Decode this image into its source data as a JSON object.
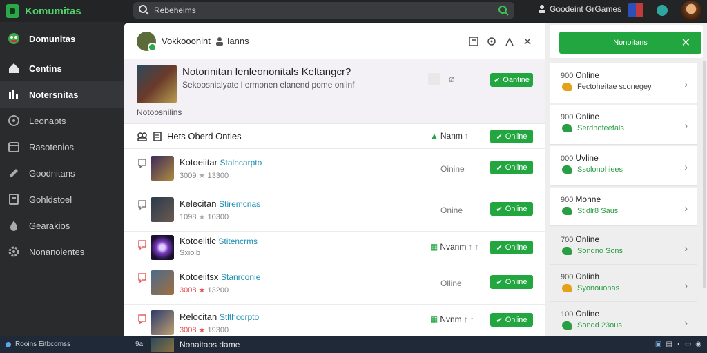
{
  "brand": {
    "name": "Komumitas"
  },
  "search": {
    "value": "Rebeheims",
    "placeholder": ""
  },
  "top_right": {
    "account_label": "Goodeint GrGames"
  },
  "sidebar": {
    "items": [
      {
        "label": "Domunitas",
        "icon": "community-icon"
      },
      {
        "label": "Centins",
        "icon": "home-icon"
      },
      {
        "label": "Notersnitas",
        "icon": "stats-icon"
      },
      {
        "label": "Leonapts",
        "icon": "compass-icon"
      },
      {
        "label": "Rasotenios",
        "icon": "calendar-icon"
      },
      {
        "label": "Goodnitans",
        "icon": "pen-icon"
      },
      {
        "label": "Gohldstoel",
        "icon": "document-icon"
      },
      {
        "label": "Gearakios",
        "icon": "drop-icon"
      },
      {
        "label": "Nonanoientes",
        "icon": "gear-icon"
      }
    ]
  },
  "header": {
    "title": "Vokkooonint",
    "subtitle": "Ianns"
  },
  "featured": {
    "title": "Notorinitan lenleononitals Keltangcr?",
    "desc": "Sekoosnialyate l ermonen elanend pome onlinf",
    "meta": "Notoosnilins",
    "count": "Ø",
    "button": "Oantine"
  },
  "section": {
    "title": "Hets Oberd Onties",
    "rank_label": "Nanm",
    "button": "Online"
  },
  "rows": [
    {
      "title": "Kotoeiitar",
      "tag": "Stalncarpto",
      "meta": "3009",
      "meta2": "13300",
      "status": "Oinine",
      "button": "Online",
      "flag_color": "#666",
      "star_red": false
    },
    {
      "title": "Kelecitan",
      "tag": "Stiremcnas",
      "meta": "1098",
      "meta2": "10300",
      "status": "Onine",
      "button": "Online",
      "flag_color": "#666",
      "star_red": false
    },
    {
      "title": "Kotoeiitlc",
      "tag": "Stitencrms",
      "meta": "Sxioib",
      "meta2": "",
      "status": "",
      "rank": "Nvanm",
      "button": "Online",
      "flag_color": "#d44",
      "star_red": false
    },
    {
      "title": "Kotoeiitsx",
      "tag": "Stanrconie",
      "meta": "3008",
      "meta2": "13200",
      "status": "Olline",
      "button": "Online",
      "flag_color": "#d44",
      "star_red": true
    },
    {
      "title": "Relocitan",
      "tag": "Stlthcorpto",
      "meta": "3008",
      "meta2": "19300",
      "status": "",
      "rank": "Nvnm",
      "button": "Online",
      "flag_color": "#d44",
      "star_red": true
    }
  ],
  "right": {
    "top_button": "Nonoitans",
    "cards": [
      {
        "top": "900",
        "label": "Online",
        "sub": "Fectoheitae sconegey",
        "icon_color": "#e3a21a",
        "sub_dark": true
      },
      {
        "top": "900",
        "label": "Online",
        "sub": "Serdnofeefals",
        "icon_color": "#2a9e44",
        "sub_dark": false
      },
      {
        "top": "000",
        "label": "Uvline",
        "sub": "Ssolonohiees",
        "icon_color": "#2a9e44",
        "sub_dark": false
      },
      {
        "top": "900",
        "label": "Mohne",
        "sub": "Stldlr8 Saus",
        "icon_color": "#2a9e44",
        "sub_dark": false
      },
      {
        "top": "700",
        "label": "Online",
        "sub": "Sondno Sons",
        "icon_color": "#2a9e44",
        "sub_dark": false
      },
      {
        "top": "900",
        "label": "Onlinh",
        "sub": "Syonouonas",
        "icon_color": "#e3a21a",
        "sub_dark": false
      },
      {
        "top": "100",
        "label": "Online",
        "sub": "Sondd 23ous",
        "icon_color": "#2a9e44",
        "sub_dark": false
      }
    ]
  },
  "bottom": {
    "left": "Rooins Eitbcomss",
    "mid": "9a.",
    "title": "Nonaitaos dame"
  }
}
